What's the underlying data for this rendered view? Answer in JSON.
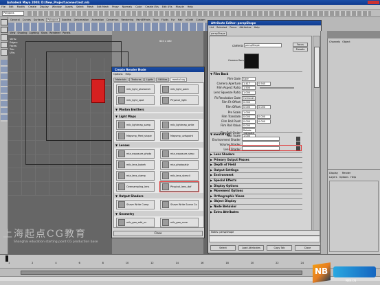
{
  "app": {
    "title": "Autodesk Maya 2008: D:\\New_Project\\scenes\\test.mb",
    "menu": [
      "File",
      "Edit",
      "Modify",
      "Create",
      "Display",
      "Window",
      "Assets",
      "Select",
      "Mesh",
      "Edit Mesh",
      "Proxy",
      "Normals",
      "Color",
      "Create UVs",
      "Edit UVs",
      "Muscle",
      "Help"
    ],
    "mode_select": "Polygons",
    "shelf_tabs": [
      "General",
      "Curves",
      "Surfaces",
      "Polygons",
      "Subdivs",
      "Deformation",
      "Animation",
      "Dynamics",
      "Rendering",
      "PaintEffects",
      "Toon",
      "Fluids",
      "Fur",
      "Hair",
      "nCloth",
      "Custom"
    ],
    "active_shelf_tab": "Polygons"
  },
  "viewport": {
    "menu": [
      "View",
      "Shading",
      "Lighting",
      "Show",
      "Renderer",
      "Panels"
    ],
    "stats": [
      "Verts:",
      "Edges:",
      "Faces:",
      "Tris:",
      "UVs:"
    ],
    "resolution": "640 x 480"
  },
  "create_render_node": {
    "title": "Create Render Node",
    "menu": [
      "Options",
      "Help"
    ],
    "tabs": [
      "Materials",
      "Textures",
      "Lights",
      "Utilities",
      "mental ray"
    ],
    "active_tab": "mental ray",
    "top_nodes": [
      [
        "mib_light_photomet",
        "mib_light_point"
      ],
      [
        "mib_light_spot",
        "Physical_light"
      ]
    ],
    "sections": [
      {
        "title": "Photon Emitters",
        "nodes": []
      },
      {
        "title": "Light Maps",
        "nodes": [
          [
            "mib_lightmap_samp",
            "mib_lightmap_write"
          ],
          [
            "Mapsmp_f9ed_shape",
            "Mapsmp_uvtspoint"
          ]
        ]
      },
      {
        "title": "Lenses",
        "nodes": [
          [
            "mia_exposure_photo",
            "mia_exposure_simp"
          ],
          [
            "mib_lens_bokeh",
            "mia_photosatiy"
          ],
          [
            "mia_lens_clamp",
            "mib_lens_stencil"
          ],
          [
            "Oversampling_lens",
            "Physical_lens_dof"
          ]
        ]
      },
      {
        "title": "Output Shaders",
        "nodes": [
          [
            "Shave Write Comp",
            "Shave Write Scene Co"
          ]
        ]
      },
      {
        "title": "Geometry",
        "nodes": [
          [
            "mib_geo_add_uv",
            "mib_geo_cone"
          ]
        ]
      }
    ],
    "close_label": "Close"
  },
  "attr_editor": {
    "title": "Attribute Editor: perspShape",
    "menu": [
      "List",
      "Selected",
      "Focus",
      "Attributes",
      "Help"
    ],
    "node_tab": "perspShape",
    "camera_label": "camera:",
    "camera_value": "perspShape",
    "focus_label": "Focus",
    "presets_label": "Presets",
    "sample_label": "Camera Sample",
    "film_back": "Film Back",
    "rows": [
      {
        "label": "Film Gate",
        "value": "User"
      },
      {
        "label": "Camera Aperture",
        "value": "1.417",
        "value2": "0.945"
      },
      {
        "label": "Film Aspect Ratio",
        "value": "1.500"
      },
      {
        "label": "Lens Squeeze Ratio",
        "value": "1.000"
      },
      {
        "label": "Fit Resolution Gate",
        "value": "Overscan"
      },
      {
        "label": "Film Fit Offset",
        "value": "0.000"
      },
      {
        "label": "Film Offset",
        "value": "0.000",
        "value2": "0.000"
      },
      {
        "label": "Pre Scale",
        "value": "1.000"
      },
      {
        "label": "Film Translate",
        "value": "0.000",
        "value2": "0.000"
      },
      {
        "label": "Film Roll Pivot",
        "value": "0.000",
        "value2": "0.000"
      },
      {
        "label": "Film Roll Value",
        "value": "0.000"
      },
      {
        "label": "Film Roll Order",
        "value": "Rotate-Translate"
      },
      {
        "label": "Post Scale",
        "value": "1.000"
      }
    ],
    "mental_ray": "mental ray",
    "mr_rows": [
      "Environment Shader",
      "Volume Shader",
      "Lens Shader"
    ],
    "sections": [
      "Lens Shaders",
      "Primary Output Passes",
      "Depth of Field",
      "Output Settings",
      "Environment",
      "Special Effects",
      "Display Options",
      "Movement Options",
      "Orthographic Views",
      "Object Display",
      "Node Behavior",
      "Extra Attributes"
    ],
    "notes_label": "Notes:",
    "notes_value": "perspShape",
    "buttons": [
      "Select",
      "Load Attributes",
      "Copy Tab",
      "Close"
    ]
  },
  "channel_box": {
    "menu": [
      "Channels",
      "Object"
    ]
  },
  "layer_editor": {
    "tabs": [
      "Display",
      "Render"
    ],
    "menu": [
      "Layers",
      "Options",
      "Help"
    ]
  },
  "timeline": {
    "ticks": [
      "1",
      "2",
      "4",
      "6",
      "8",
      "10",
      "12",
      "14",
      "16",
      "18",
      "20",
      "22",
      "24"
    ]
  },
  "watermark": {
    "cn": "上海起点CG教育",
    "en": "Shanghai education starting point CG production base",
    "logo_text": "NB",
    "logo_site": "NBS.CN"
  },
  "colors": {
    "accent_red": "#e03030",
    "selection_blue": "#0f3b8f",
    "viewport_grey": "#5d5d5d"
  }
}
